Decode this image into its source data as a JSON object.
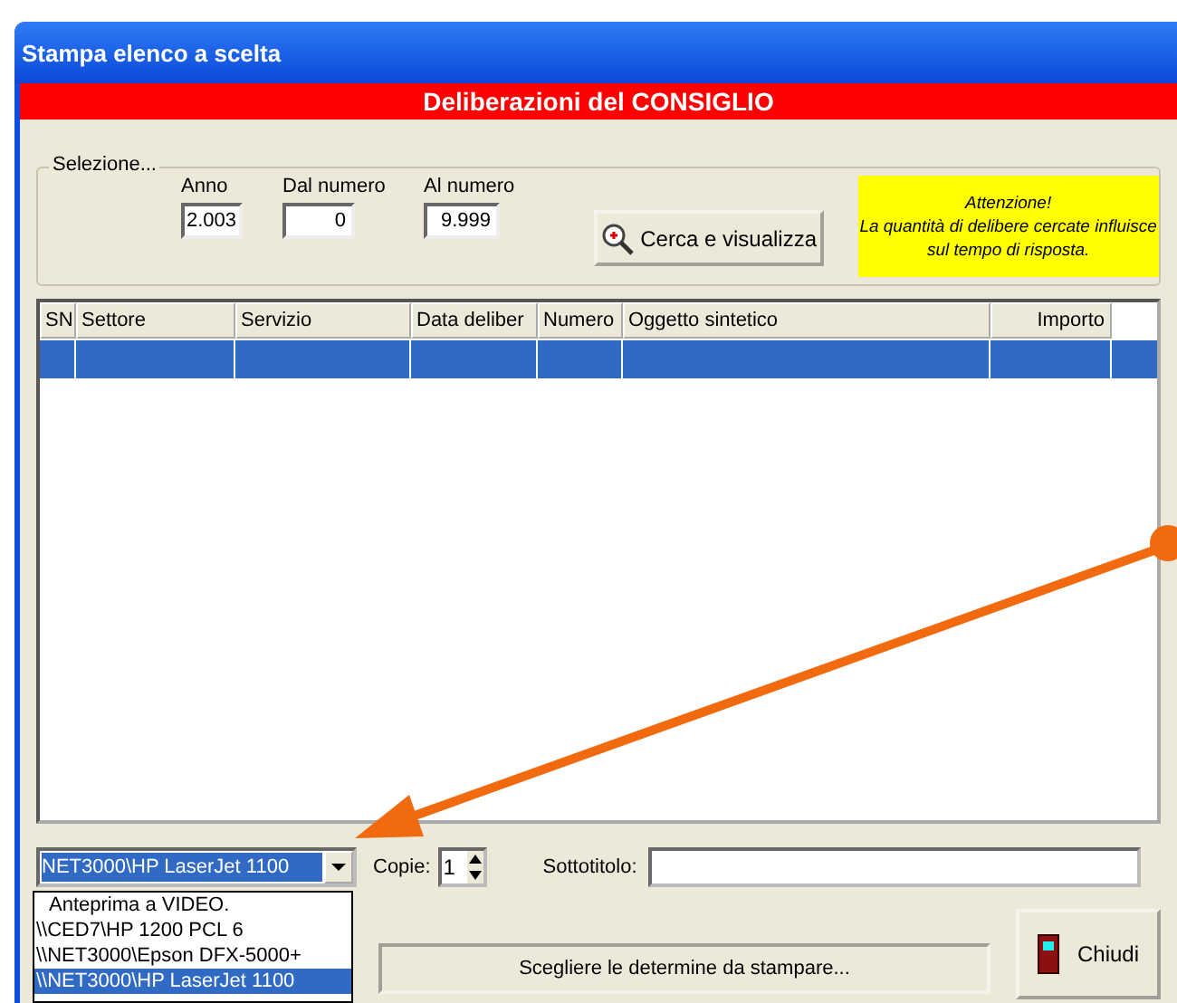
{
  "window": {
    "title": "Stampa elenco a scelta"
  },
  "banner": "Deliberazioni del CONSIGLIO",
  "selection": {
    "legend": "Selezione...",
    "fields": [
      {
        "label": "Anno",
        "value": "2.003"
      },
      {
        "label": "Dal numero",
        "value": "0"
      },
      {
        "label": "Al numero",
        "value": "9.999"
      }
    ],
    "search_button": "Cerca e visualizza",
    "notice": [
      "Attenzione!",
      "La quantità di delibere cercate influisce",
      "sul tempo di risposta."
    ]
  },
  "table": {
    "columns": [
      "SN",
      "Settore",
      "Servizio",
      "Data deliber",
      "Numero",
      "Oggetto sintetico",
      "Importo"
    ],
    "rows": [
      {
        "selected": true
      }
    ]
  },
  "printer": {
    "value": "NET3000\\HP LaserJet 1100",
    "options": [
      {
        "label": "Anteprima a VIDEO.",
        "selected": false
      },
      {
        "label": "\\\\CED7\\HP 1200 PCL 6",
        "selected": false
      },
      {
        "label": "\\\\NET3000\\Epson DFX-5000+",
        "selected": false
      },
      {
        "label": "\\\\NET3000\\HP LaserJet 1100",
        "selected": true
      }
    ]
  },
  "copies": {
    "label": "Copie:",
    "value": "1"
  },
  "subtitle": {
    "label": "Sottotitolo:"
  },
  "choose_button": "Scegliere le determine da stampare...",
  "close_button": "Chiudi"
}
